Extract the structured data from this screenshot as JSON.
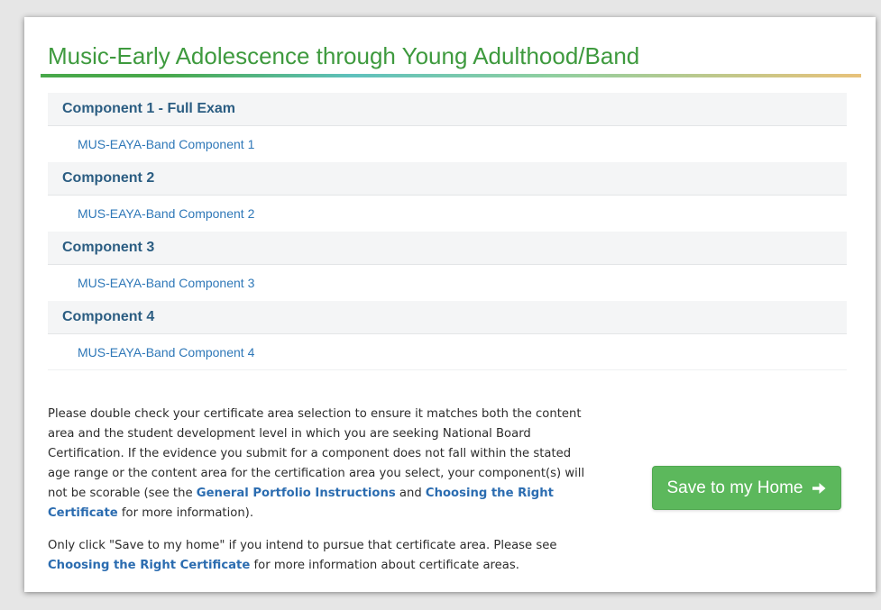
{
  "page": {
    "title": "Music-Early Adolescence through Young Adulthood/Band"
  },
  "components": [
    {
      "header": "Component 1 - Full Exam",
      "link": "MUS-EAYA-Band Component 1"
    },
    {
      "header": "Component 2",
      "link": "MUS-EAYA-Band Component 2"
    },
    {
      "header": "Component 3",
      "link": "MUS-EAYA-Band Component 3"
    },
    {
      "header": "Component 4",
      "link": "MUS-EAYA-Band Component 4"
    }
  ],
  "notice": {
    "p1_text1": "Please double check your certificate area selection to ensure it matches both the content area and the student development level in which you are seeking National Board Certification.  If the evidence you submit for a component does not fall within the stated age range or the content area for the certification area you select, your component(s) will not be scorable (see the ",
    "p1_link1": "General Portfolio Instructions",
    "p1_text2": " and ",
    "p1_link2": "Choosing the Right Certificate",
    "p1_text3": " for more information).",
    "p2_text1": "Only click \"Save to my home\" if you intend to pursue that certificate area.  Please see ",
    "p2_link1": "Choosing the Right Certificate",
    "p2_text2": " for more information about certificate areas."
  },
  "save_button": {
    "label": "Save to my Home",
    "icon": "arrow-right-icon"
  },
  "colors": {
    "title_green": "#3e9a3e",
    "header_blue": "#2b5d82",
    "link_blue": "#2f78b8",
    "button_green": "#5cb85c"
  }
}
